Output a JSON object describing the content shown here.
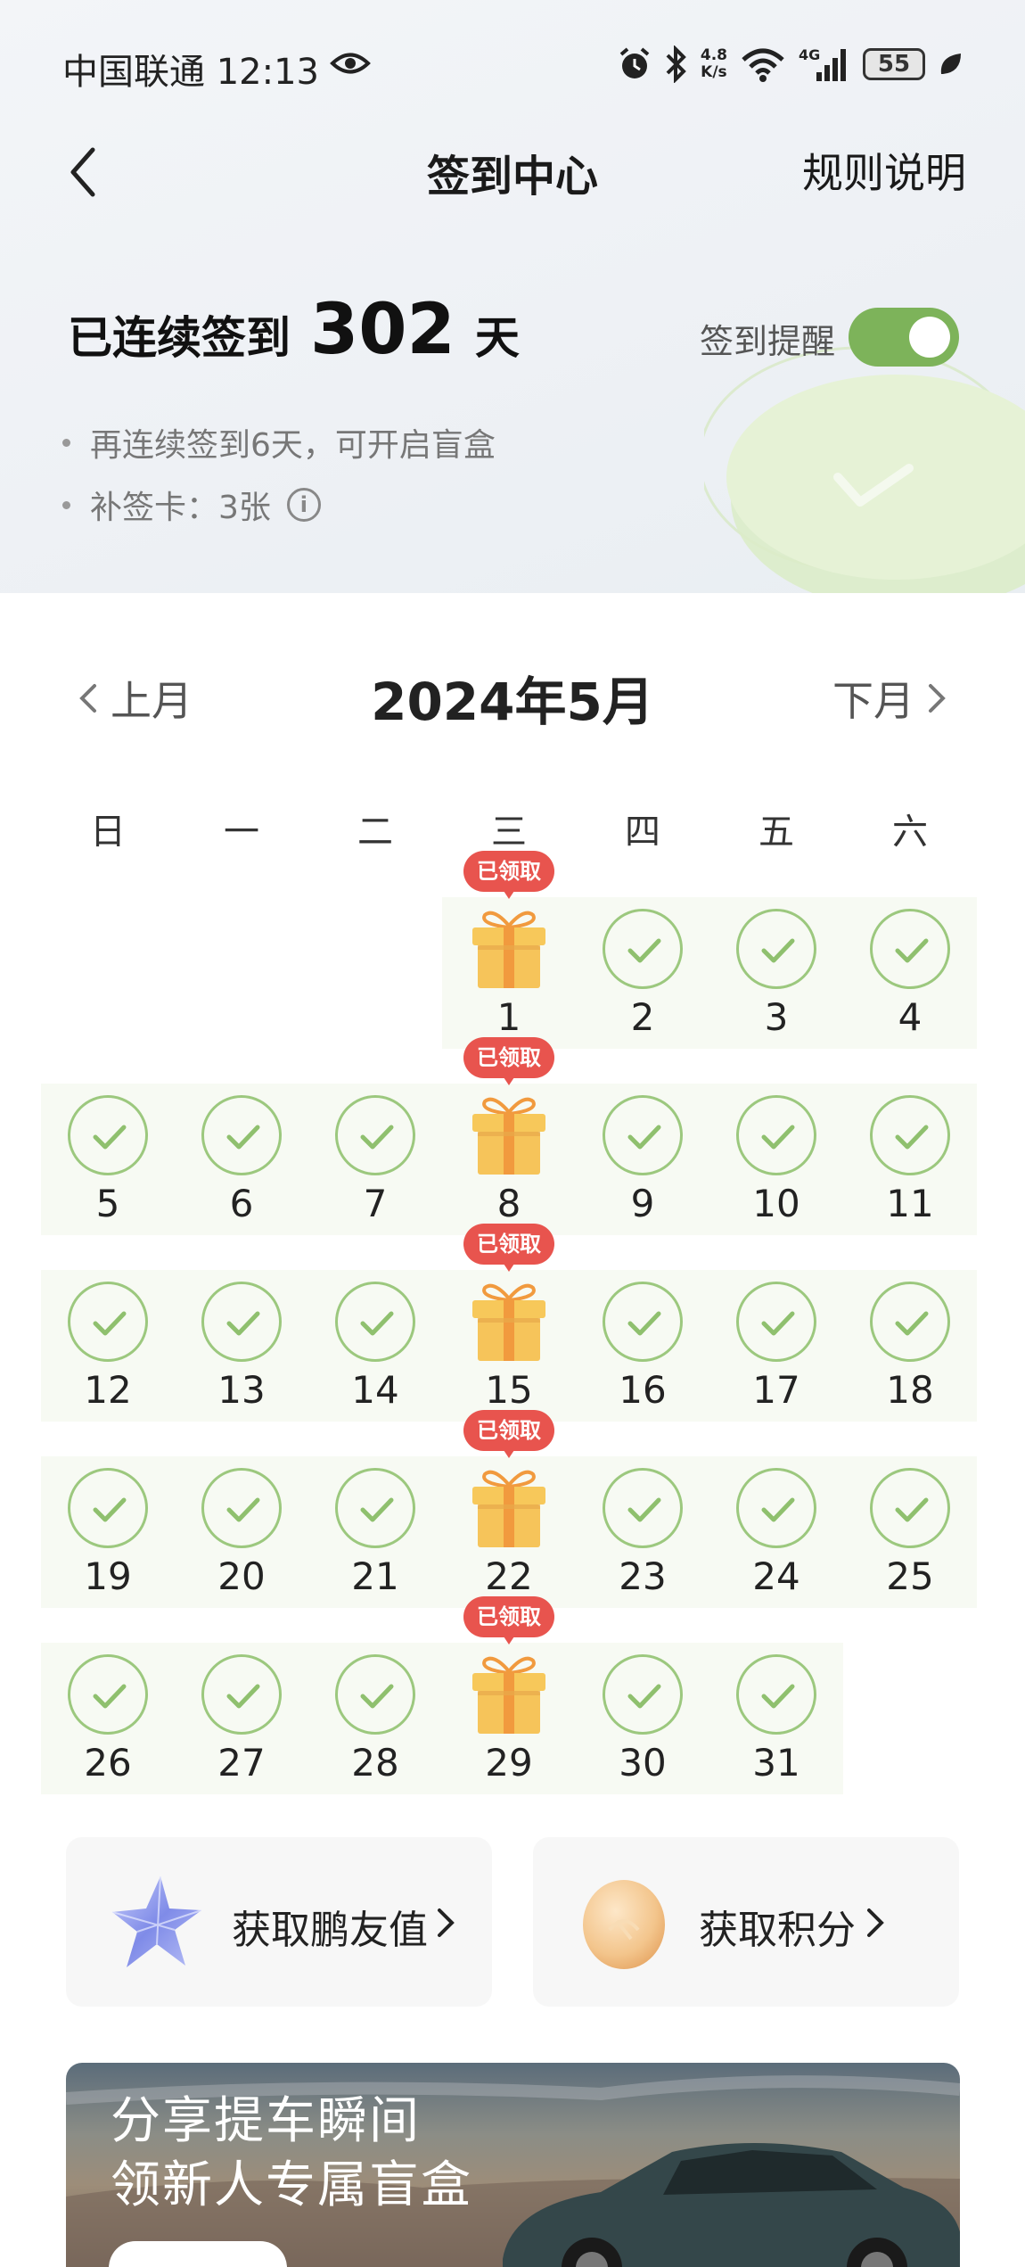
{
  "status": {
    "carrier": "中国联通",
    "time": "12:13",
    "net_speed_value": "4.8",
    "net_speed_unit": "K/s",
    "wifi_badge": "6",
    "cell_badge": "4G",
    "battery": "55"
  },
  "nav": {
    "title": "签到中心",
    "rules": "规则说明"
  },
  "streak": {
    "prefix": "已连续签到",
    "days": "302",
    "suffix": "天",
    "reminder_label": "签到提醒",
    "reminder_on": true
  },
  "hints": [
    "再连续签到6天，可开启盲盒",
    "补签卡：3张"
  ],
  "calendar": {
    "prev": "上月",
    "title": "2024年5月",
    "next": "下月",
    "weekdays": [
      "日",
      "一",
      "二",
      "三",
      "四",
      "五",
      "六"
    ],
    "first_weekday_index": 3,
    "days_in_month": 31,
    "claimed_label": "已领取",
    "gift_days": [
      1,
      8,
      15,
      22,
      29
    ]
  },
  "cards": {
    "friend_value": "获取鹏友值",
    "points": "获取积分"
  },
  "banner": {
    "line1": "分享提车瞬间",
    "line2": "领新人专属盲盒"
  },
  "colors": {
    "accent_green": "#7db35a",
    "check_green": "#9cc87e",
    "badge_red": "#e8544e",
    "gift_gold": "#f6c45a"
  }
}
